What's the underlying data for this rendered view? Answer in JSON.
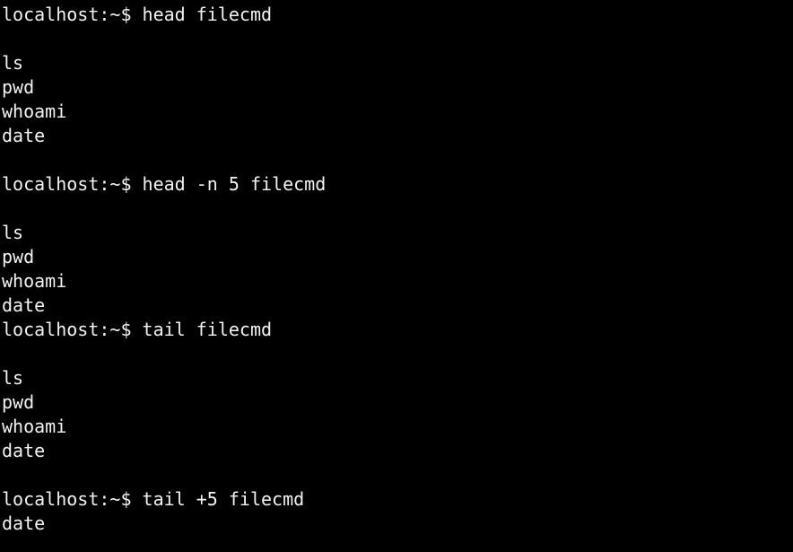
{
  "terminal": {
    "background": "#000000",
    "foreground": "#f2f2f2",
    "lines": [
      "localhost:~$ head filecmd",
      "",
      "ls",
      "pwd",
      "whoami",
      "date",
      "",
      "localhost:~$ head -n 5 filecmd",
      "",
      "ls",
      "pwd",
      "whoami",
      "date",
      "localhost:~$ tail filecmd",
      "",
      "ls",
      "pwd",
      "whoami",
      "date",
      "",
      "localhost:~$ tail +5 filecmd",
      "date"
    ]
  }
}
